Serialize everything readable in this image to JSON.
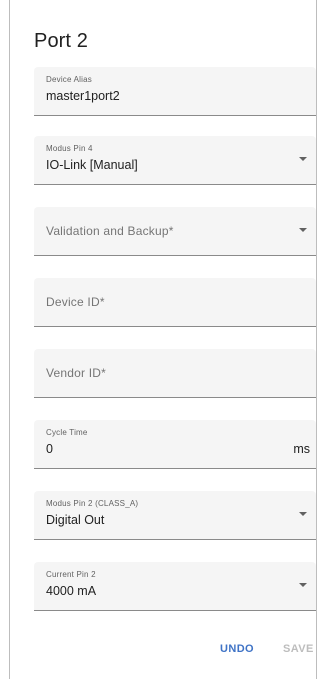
{
  "title": "Port 2",
  "fields": {
    "device_alias": {
      "label": "Device Alias",
      "value": "master1port2"
    },
    "modus_pin4": {
      "label": "Modus Pin 4",
      "value": "IO-Link [Manual]"
    },
    "validation_backup": {
      "placeholder": "Validation and Backup*"
    },
    "device_id": {
      "placeholder": "Device ID*"
    },
    "vendor_id": {
      "placeholder": "Vendor ID*"
    },
    "cycle_time": {
      "label": "Cycle Time",
      "value": "0",
      "unit": "ms"
    },
    "modus_pin2": {
      "label": "Modus Pin 2 (CLASS_A)",
      "value": "Digital Out"
    },
    "current_pin2": {
      "label": "Current Pin 2",
      "value": "4000 mA"
    }
  },
  "actions": {
    "undo_label": "UNDO",
    "save_label": "SAVE"
  },
  "colors": {
    "accent": "#3f73c6",
    "disabled": "#bdbdbd",
    "field_bg": "#f5f5f5"
  }
}
